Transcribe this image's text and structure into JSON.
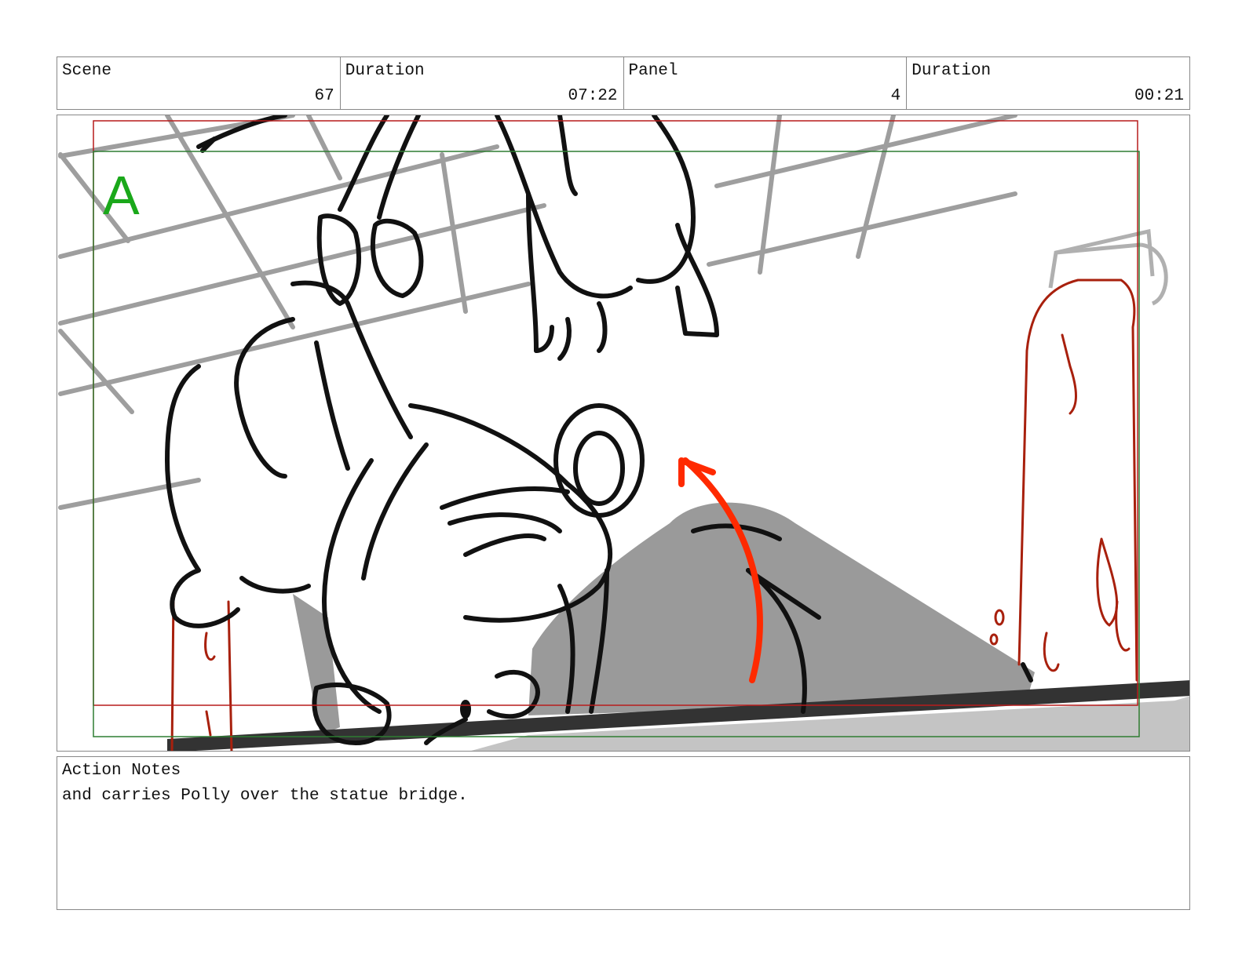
{
  "header": {
    "scene": {
      "label": "Scene",
      "value": "67"
    },
    "scene_duration": {
      "label": "Duration",
      "value": "07:22"
    },
    "panel": {
      "label": "Panel",
      "value": "4"
    },
    "panel_duration": {
      "label": "Duration",
      "value": "00:21"
    }
  },
  "panel_image": {
    "layer_marker": "A",
    "colors": {
      "safe_frame": "#b71c1c",
      "action_frame": "#2e7d32",
      "marker": "#1aa81a",
      "motion_arrow": "#ff2a00",
      "statue_outline": "#a8200d",
      "grid": "#9e9e9e",
      "shadow": "#9a9a9a"
    }
  },
  "notes": {
    "label": "Action Notes",
    "text": "and carries Polly over the statue bridge."
  }
}
